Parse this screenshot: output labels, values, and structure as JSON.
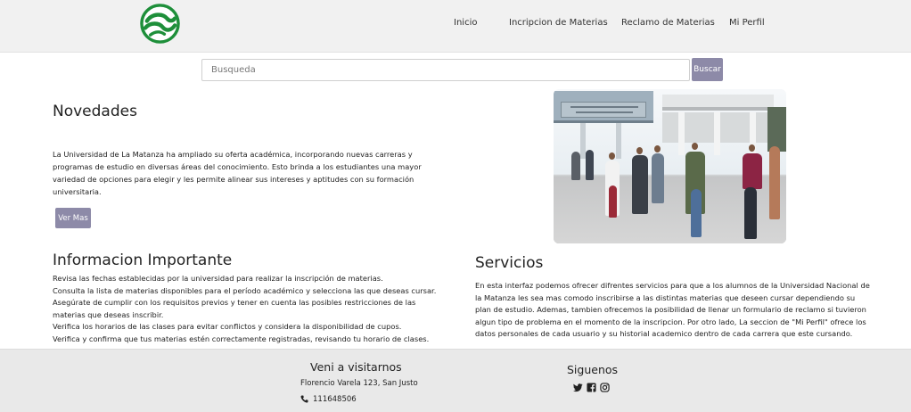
{
  "nav": {
    "logo_icon": "green-circular-wave-logo",
    "links": [
      "Inicio",
      "Incripcion de Materias",
      "Reclamo de Materias",
      "Mi Perfil"
    ]
  },
  "search": {
    "placeholder": "Busqueda",
    "value": "",
    "button_label": "Buscar"
  },
  "novedades": {
    "title": "Novedades",
    "body": "La Universidad de La Matanza ha ampliado su oferta académica, incorporando nuevas carreras y programas de estudio en diversas áreas del conocimiento. Esto brinda a los estudiantes una mayor variedad de opciones para elegir y les permite alinear sus intereses y aptitudes con su formación universitaria.",
    "button_label": "Ver Mas"
  },
  "photo": {
    "sign_text": "UNIVERSIDAD NACIONAL DE LA MATANZA"
  },
  "info": {
    "title": "Informacion Importante",
    "items": [
      "Revisa las fechas establecidas por la universidad para realizar la inscripción de materias.",
      "Consulta la lista de materias disponibles para el período académico y selecciona las que deseas cursar.",
      "Asegúrate de cumplir con los requisitos previos y tener en cuenta las posibles restricciones de las materias que deseas inscribir.",
      "Verifica los horarios de las clases para evitar conflictos y considera la disponibilidad de cupos.",
      "Verifica y confirma que tus materias estén correctamente registradas, revisando tu horario de clases."
    ]
  },
  "servicios": {
    "title": "Servicios",
    "body": "En esta interfaz podemos ofrecer difrentes servicios para que a los alumnos de la Universidad Nacional de la Matanza les sea mas comodo inscribirse a las distintas materias que deseen cursar dependiendo su plan de estudio. Ademas, tambien ofrecemos la posibilidad de llenar un formulario de reclamo si tuvieron algun tipo de problema en el momento de la inscripcion. Por otro lado, La seccion de \"Mi Perfil\" ofrece los datos personales de cada usuario y su historial academico dentro de cada carrera que este cursando."
  },
  "footer": {
    "visit_title": "Veni a visitarnos",
    "address": "Florencio Varela 123, San Justo",
    "phone": "111648506",
    "follow_title": "Siguenos",
    "social_icons": [
      "twitter-icon",
      "facebook-icon",
      "instagram-icon"
    ]
  },
  "colors": {
    "accent_button": "#8d8aa8",
    "logo_green": "#1e8f3a",
    "navbar_bg": "#f1f1f1",
    "footer_bg": "#e9e9e9"
  }
}
